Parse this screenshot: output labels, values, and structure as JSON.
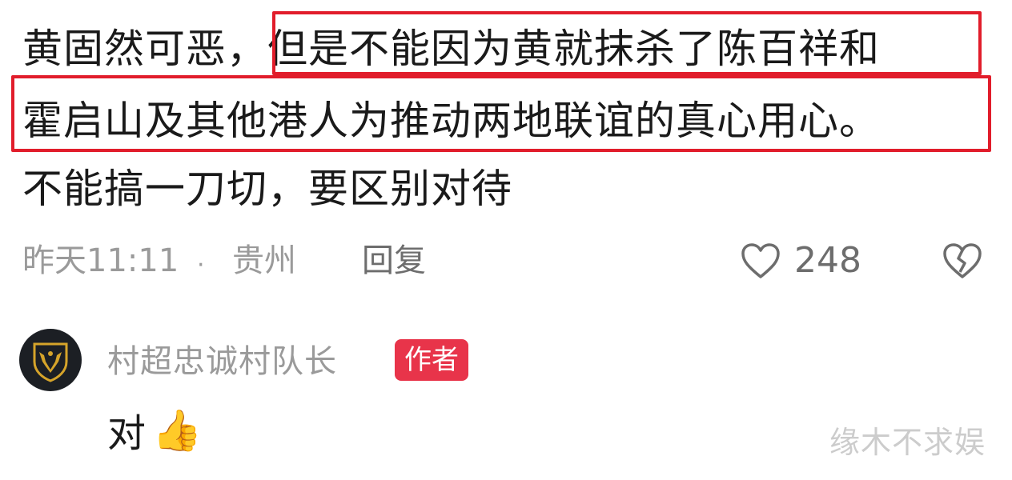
{
  "comment": {
    "line1_prefix": "黄固然可恶，",
    "line1_highlight": "但是不能因为黄就抹杀了陈百祥和",
    "line2_highlight": "霍启山及其他港人为推动两地联谊的真心用心。",
    "line3": "不能搞一刀切，要区别对待",
    "time": "昨天11:11",
    "separator": "·",
    "location": "贵州",
    "reply_label": "回复",
    "like_icon": "heart-outline-icon",
    "like_count": "248",
    "dislike_icon": "broken-heart-icon"
  },
  "author_reply": {
    "avatar_icon": "bull-shield-avatar",
    "name": "村超忠诚村队长",
    "badge": "作者",
    "text": "对",
    "emoji": "👍"
  },
  "watermark": "缘木不求娱",
  "colors": {
    "highlight_border": "#e11d2b",
    "badge_bg": "#e8344a",
    "meta_text": "#9a9a9a"
  }
}
